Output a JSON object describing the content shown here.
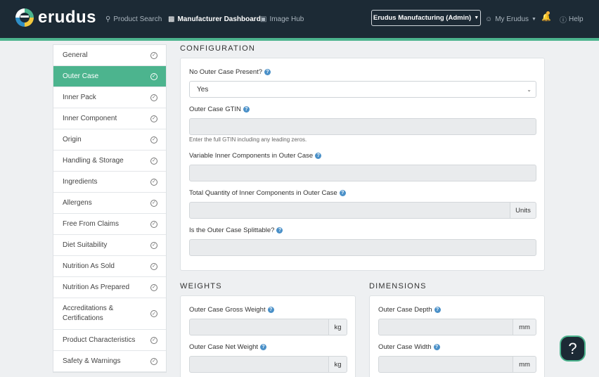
{
  "header": {
    "brand": "erudus",
    "nav": [
      {
        "label": "Product Search",
        "icon": "search-icon"
      },
      {
        "label": "Manufacturer Dashboard",
        "icon": "chart-icon"
      },
      {
        "label": "Image Hub",
        "icon": "camera-icon"
      }
    ],
    "account_label": "Erudus Manufacturing (Admin)",
    "my_erudus_label": "My Erudus",
    "help_label": "Help"
  },
  "sidebar": {
    "items": [
      {
        "label": "General"
      },
      {
        "label": "Outer Case",
        "active": true
      },
      {
        "label": "Inner Pack"
      },
      {
        "label": "Inner Component"
      },
      {
        "label": "Origin"
      },
      {
        "label": "Handling & Storage"
      },
      {
        "label": "Ingredients"
      },
      {
        "label": "Allergens"
      },
      {
        "label": "Free From Claims"
      },
      {
        "label": "Diet Suitability"
      },
      {
        "label": "Nutrition As Sold"
      },
      {
        "label": "Nutrition As Prepared"
      },
      {
        "label": "Accreditations &",
        "label2": "Certifications"
      },
      {
        "label": "Product Characteristics"
      },
      {
        "label": "Safety & Warnings"
      }
    ]
  },
  "configuration": {
    "title": "CONFIGURATION",
    "no_outer_case_label": "No Outer Case Present?",
    "no_outer_case_value": "Yes",
    "gtin_label": "Outer Case GTIN",
    "gtin_help": "Enter the full GTIN including any leading zeros.",
    "variable_label": "Variable Inner Components in Outer Case",
    "total_qty_label": "Total Quantity of Inner Components in Outer Case",
    "total_qty_unit": "Units",
    "splittable_label": "Is the Outer Case Splittable?"
  },
  "weights": {
    "title": "WEIGHTS",
    "gross_label": "Outer Case Gross Weight",
    "gross_unit": "kg",
    "net_label": "Outer Case Net Weight",
    "net_unit": "kg"
  },
  "dimensions": {
    "title": "DIMENSIONS",
    "depth_label": "Outer Case Depth",
    "depth_unit": "mm",
    "width_label": "Outer Case Width",
    "width_unit": "mm"
  },
  "colors": {
    "brand_green": "#4cb48e",
    "header_bg": "#1c2a35",
    "help_blue": "#4a90c8"
  }
}
